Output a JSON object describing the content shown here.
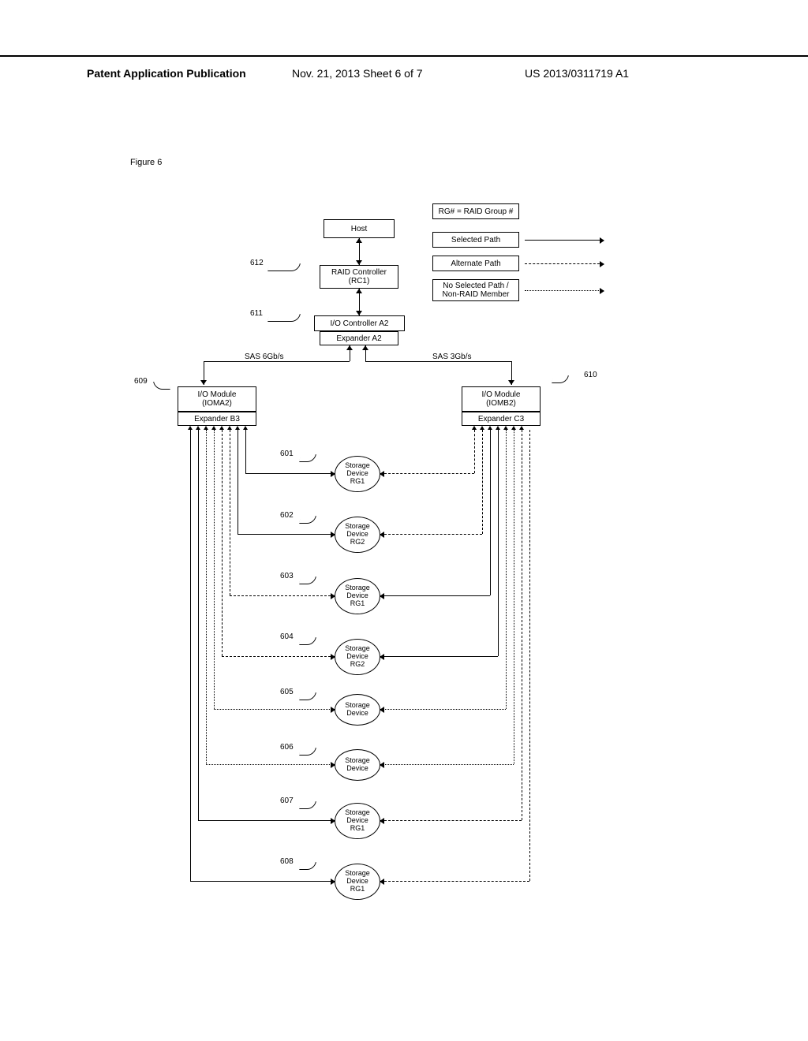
{
  "header": {
    "left": "Patent Application Publication",
    "mid": "Nov. 21, 2013  Sheet 6 of 7",
    "right": "US 2013/0311719 A1"
  },
  "figure_label": "Figure 6",
  "legend": {
    "rg_note": "RG#  = RAID Group #",
    "selected": "Selected Path",
    "alternate": "Alternate Path",
    "nopath": "No Selected Path /\nNon-RAID Member"
  },
  "blocks": {
    "host": "Host",
    "raid": "RAID Controller\n(RC1)",
    "ioctrl": "I/O Controller A2",
    "expA": "Expander A2",
    "iomod_a": "I/O Module\n(IOMA2)",
    "expB": "Expander B3",
    "iomod_b": "I/O Module\n(IOMB2)",
    "expC": "Expander C3",
    "sas6": "SAS 6Gb/s",
    "sas3": "SAS 3Gb/s",
    "sd601": "Storage\nDevice\nRG1",
    "sd602": "Storage\nDevice\nRG2",
    "sd603": "Storage\nDevice\nRG1",
    "sd604": "Storage\nDevice\nRG2",
    "sd605": "Storage\nDevice",
    "sd606": "Storage\nDevice",
    "sd607": "Storage\nDevice\nRG1",
    "sd608": "Storage\nDevice\nRG1"
  },
  "refs": {
    "r601": "601",
    "r602": "602",
    "r603": "603",
    "r604": "604",
    "r605": "605",
    "r606": "606",
    "r607": "607",
    "r608": "608",
    "r609": "609",
    "r610": "610",
    "r611": "611",
    "r612": "612"
  }
}
